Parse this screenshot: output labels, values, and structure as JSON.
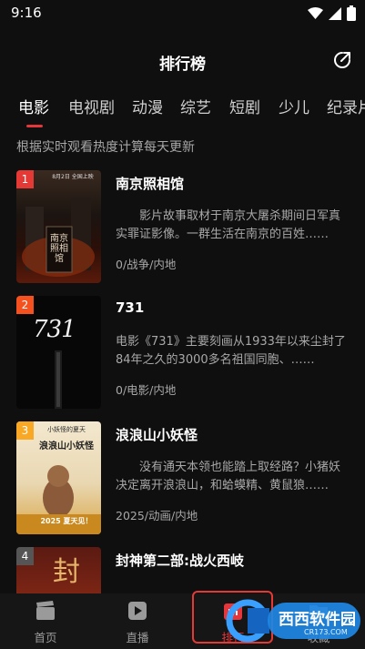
{
  "status": {
    "time": "9:16"
  },
  "header": {
    "title": "排行榜"
  },
  "tabs": [
    {
      "label": "电影"
    },
    {
      "label": "电视剧"
    },
    {
      "label": "动漫"
    },
    {
      "label": "综艺"
    },
    {
      "label": "短剧"
    },
    {
      "label": "少儿"
    },
    {
      "label": "纪录片"
    }
  ],
  "subtitle": "根据实时观看热度计算每天更新",
  "items": [
    {
      "rank": "1",
      "rank_color": "#e53935",
      "title": "南京照相馆",
      "desc": "影片故事取材于南京大屠杀期间日军真实罪证影像。一群生活在南京的百姓……",
      "meta": "0/战争/内地",
      "poster_text": "南京照相馆",
      "poster_top": "8月2日 全国上映"
    },
    {
      "rank": "2",
      "rank_color": "#f4511e",
      "title": "731",
      "desc": "电影《731》主要刻画从1933年以来尘封了84年之久的3000多名祖国同胞、……",
      "meta": "0/电影/内地",
      "poster_text": "731"
    },
    {
      "rank": "3",
      "rank_color": "#f9a825",
      "title": "浪浪山小妖怪",
      "desc": "没有通天本领也能踏上取经路？小猪妖决定离开浪浪山，和蛤蟆精、黄鼠狼……",
      "meta": "2025/动画/内地",
      "poster_text": "浪浪山小妖怪",
      "poster_top": "小妖怪的夏天",
      "poster_bottom": "2025 夏天见！"
    },
    {
      "rank": "4",
      "rank_color": "#555555",
      "title": "封神第二部:战火西岐",
      "desc": "",
      "meta": "",
      "poster_text": "封"
    }
  ],
  "bottom_nav": [
    {
      "label": "首页",
      "icon": "clapperboard-icon"
    },
    {
      "label": "直播",
      "icon": "play-icon"
    },
    {
      "label": "排行",
      "icon": "rank-icon"
    },
    {
      "label": "收藏",
      "icon": "folder-icon"
    }
  ],
  "watermark": {
    "text": "西西软件园",
    "url": "CR173.COM"
  }
}
